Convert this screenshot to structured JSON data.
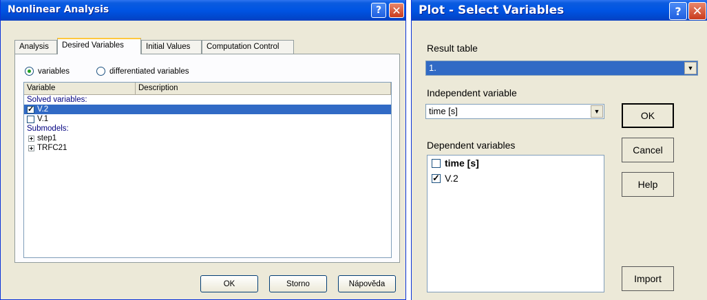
{
  "nonlinear": {
    "title": "Nonlinear Analysis",
    "help_glyph": "?",
    "close_glyph": "✕",
    "tabs": [
      "Analysis",
      "Desired Variables",
      "Initial Values",
      "Computation Control"
    ],
    "radio_variables": "variables",
    "radio_differentiated": "differentiated variables",
    "columns": [
      "Variable",
      "Description"
    ],
    "solved_group": "Solved variables:",
    "solved": [
      {
        "name": "V.2",
        "checked": true,
        "selected": true
      },
      {
        "name": "V.1",
        "checked": false,
        "selected": false
      }
    ],
    "submodels_group": "Submodels:",
    "submodels": [
      "step1",
      "TRFC21"
    ],
    "ok_label": "OK",
    "cancel_label": "Storno",
    "help_label": "Nápověda"
  },
  "plot": {
    "title": "Plot - Select Variables",
    "help_glyph": "?",
    "close_glyph": "✕",
    "result_table_label": "Result table",
    "result_table_value": "1.",
    "independent_label": "Independent variable",
    "independent_value": "time [s]",
    "dependent_label": "Dependent variables",
    "dependent": [
      {
        "name": "time [s]",
        "checked": false,
        "bold": true
      },
      {
        "name": "V.2",
        "checked": true,
        "bold": false
      }
    ],
    "ok_label": "OK",
    "cancel_label": "Cancel",
    "help_label": "Help",
    "import_label": "Import",
    "arrow_glyph": "▼"
  }
}
